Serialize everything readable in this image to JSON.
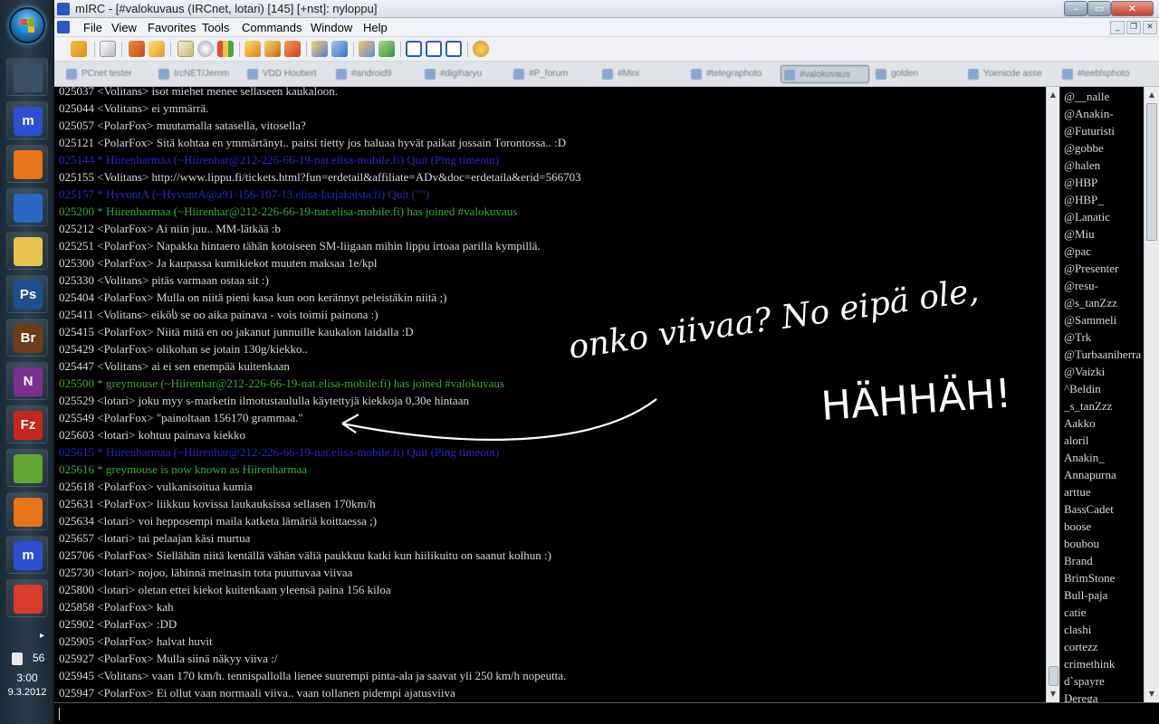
{
  "window": {
    "title": "mIRC - [#valokuvaus (IRCnet, lotari) [145] [+nst]: nyloppu]",
    "minimize": "–",
    "maximize": "▭",
    "close": "✕"
  },
  "menu": {
    "items": [
      "File",
      "View",
      "Favorites",
      "Tools",
      "Commands",
      "Window",
      "Help"
    ],
    "mdi_min": "_",
    "mdi_restore": "❐",
    "mdi_close": "✕"
  },
  "taskbar": {
    "apps": [
      {
        "icon": "monitor-icon",
        "label": "",
        "color": "#3a4f63"
      },
      {
        "icon": "mirc-icon",
        "label": "m",
        "color": "#2b4fd0"
      },
      {
        "icon": "firefox-icon",
        "label": "",
        "color": "#e8741a"
      },
      {
        "icon": "thunderbird-icon",
        "label": "",
        "color": "#2a67c2"
      },
      {
        "icon": "explorer-icon",
        "label": "",
        "color": "#e8c350"
      },
      {
        "icon": "photoshop-icon",
        "label": "Ps",
        "color": "#1c4f8c"
      },
      {
        "icon": "bridge-icon",
        "label": "Br",
        "color": "#6b3b1a"
      },
      {
        "icon": "onenote-icon",
        "label": "N",
        "color": "#7b2f8f"
      },
      {
        "icon": "filezilla-icon",
        "label": "Fz",
        "color": "#c7261c"
      },
      {
        "icon": "spotify-icon",
        "label": "",
        "color": "#62a630"
      },
      {
        "icon": "firefox-icon",
        "label": "",
        "color": "#e8741a"
      },
      {
        "icon": "mirc-icon",
        "label": "m",
        "color": "#2b4fd0"
      },
      {
        "icon": "chrome-icon",
        "label": "",
        "color": "#d93a2b"
      }
    ],
    "tray_arrow": "▸",
    "tray_count": "56",
    "clock_time": "3:00",
    "clock_date": "9.3.2012"
  },
  "switchbar": {
    "tabs": [
      "PCnet tester",
      "IrcNET/Jemm",
      "VDD Houbert",
      "#android9",
      "#digiharyu",
      "#P_forum",
      "#Mini",
      "#telegraphoto",
      "#valokuvaus",
      "golden",
      "Yoenicde asse",
      "#teeblsphoto"
    ],
    "active_index": 8
  },
  "chat": {
    "lines": [
      {
        "type": "msg",
        "text": "025037 <Volitans> isot miehet menee sellaseen kaukaloon."
      },
      {
        "type": "msg",
        "text": "025044 <Volitans> ei ymmärrä."
      },
      {
        "type": "msg",
        "text": "025057 <PolarFox> muutamalla satasella, vitosella?"
      },
      {
        "type": "msg",
        "text": "025121 <PolarFox> Sitä kohtaa en ymmärtänyt.. paitsi tietty jos haluaa hyvät paikat jossain Torontossa.. :D"
      },
      {
        "type": "quit",
        "text": "025144 * Hiirenharmaa (~Hiirenhar@212-226-66-19-nat.elisa-mobile.fi) Quit (Ping timeout)"
      },
      {
        "type": "msg",
        "text": "025155 <Volitans> http://www.lippu.fi/tickets.html?fun=erdetail&affiliate=ADv&doc=erdetaila&erid=566703"
      },
      {
        "type": "quit",
        "text": "025157 * HyvontA (~HyvontA@a91-156-107-13.elisa-laajakaista.fi) Quit (\"\")"
      },
      {
        "type": "join",
        "text": "025200 * Hiirenharmaa (~Hiirenhar@212-226-66-19-nat.elisa-mobile.fi) has joined #valokuvaus"
      },
      {
        "type": "msg",
        "text": "025212 <PolarFox> Ai niin juu.. MM-lätkää :b"
      },
      {
        "type": "msg",
        "text": "025251 <PolarFox> Napakka hintaero tähän kotoiseen SM-liigaan mihin lippu irtoaa parilla kympillä."
      },
      {
        "type": "msg",
        "text": "025300 <PolarFox> Ja kaupassa kumikiekot muuten maksaa 1e/kpl"
      },
      {
        "type": "msg",
        "text": "025330 <Volitans> pitäs varmaan ostaa sit :)"
      },
      {
        "type": "msg",
        "text": "025404 <PolarFox> Mulla on niitä pieni kasa kun oon kerännyt peleistäkin niitä ;)"
      },
      {
        "type": "msg",
        "text": "025411 <Volitans> eiköს se oo aika painava - vois toimii painona :)"
      },
      {
        "type": "msg",
        "text": "025415 <PolarFox> Niitä mitä en oo jakanut junnuille kaukalon laidalla :D"
      },
      {
        "type": "msg",
        "text": "025429 <PolarFox> olikohan se jotain 130g/kiekko.."
      },
      {
        "type": "msg",
        "text": "025447 <Volitans> ai ei sen enempää kuitenkaan"
      },
      {
        "type": "join",
        "text": "025500 * greymouse (~Hiirenhar@212-226-66-19-nat.elisa-mobile.fi) has joined #valokuvaus"
      },
      {
        "type": "msg",
        "text": "025529 <lotari> joku myy s-marketin ilmotustaululla käytettyjä kiekkoja 0,30e hintaan"
      },
      {
        "type": "msg",
        "text": "025549 <PolarFox> \"painoltaan 156170 grammaa.\""
      },
      {
        "type": "msg",
        "text": "025603 <lotari> kohtuu painava kiekko"
      },
      {
        "type": "quit",
        "text": "025615 * Hiirenharmaa (~Hiirenhar@212-226-66-19-nat.elisa-mobile.fi) Quit (Ping timeout)"
      },
      {
        "type": "join",
        "text": "025616 * greymouse is now known as Hiirenharmaa"
      },
      {
        "type": "msg",
        "text": "025618 <PolarFox> vulkanisoitua kumia"
      },
      {
        "type": "msg",
        "text": "025631 <PolarFox> liikkuu kovissa laukauksissa sellasen 170km/h"
      },
      {
        "type": "msg",
        "text": "025634 <lotari> voi hepposempi maila katketa lämäriä koittaessa ;)"
      },
      {
        "type": "msg",
        "text": "025657 <lotari> tai pelaajan käsi murtua"
      },
      {
        "type": "msg",
        "text": "025706 <PolarFox> Siellähän niitä kentällä vähän väliä paukkuu katki kun hiilikuitu on saanut kolhun :)"
      },
      {
        "type": "msg",
        "text": "025730 <lotari> nojoo, lähinnä meinasin tota puuttuvaa viivaa"
      },
      {
        "type": "msg",
        "text": "025800 <lotari> oletan ettei kiekot kuitenkaan yleensä paina 156 kiloa"
      },
      {
        "type": "msg",
        "text": "025858 <PolarFox> kah"
      },
      {
        "type": "msg",
        "text": "025902 <PolarFox> :DD"
      },
      {
        "type": "msg",
        "text": "025905 <PolarFox> halvat huvit"
      },
      {
        "type": "msg",
        "text": "025927 <PolarFox> Mulla siinä näkyy viiva :/"
      },
      {
        "type": "msg",
        "text": "025945 <Volitans> vaan 170 km/h. tennispallolla lienee suurempi pinta-ala ja saavat yli 250 km/h nopeutta."
      },
      {
        "type": "msg",
        "text": "025947 <PolarFox> Ei ollut vaan normaali viiva.. vaan tollanen pidempi ajatusviiva"
      }
    ],
    "doodle_line1": "onko viivaa? No eipä ole,",
    "doodle_line2": "HÄHHÄH!"
  },
  "nicklist": {
    "nicks": [
      "@__nalle",
      "@Anakin-",
      "@Futuristi",
      "@gobbe",
      "@halen",
      "@HBP",
      "@HBP_",
      "@Lanatic",
      "@Miu",
      "@pac",
      "@Presenter",
      "@resu-",
      "@s_tanZzz",
      "@Sammeli",
      "@Trk",
      "@Turbaaniherra",
      "@Vaizki",
      "^Beldin",
      "_s_tanZzz",
      "Aakko",
      "aloril",
      "Anakin_",
      "Annapurna",
      "arttue",
      "BassCadet",
      "boose",
      "boubou",
      "Brand",
      "BrimStone",
      "Bull-paja",
      "catie",
      "clashi",
      "cortezz",
      "crimethink",
      "d`spayre",
      "Derega"
    ]
  },
  "input": {
    "value": "",
    "placeholder": ""
  }
}
